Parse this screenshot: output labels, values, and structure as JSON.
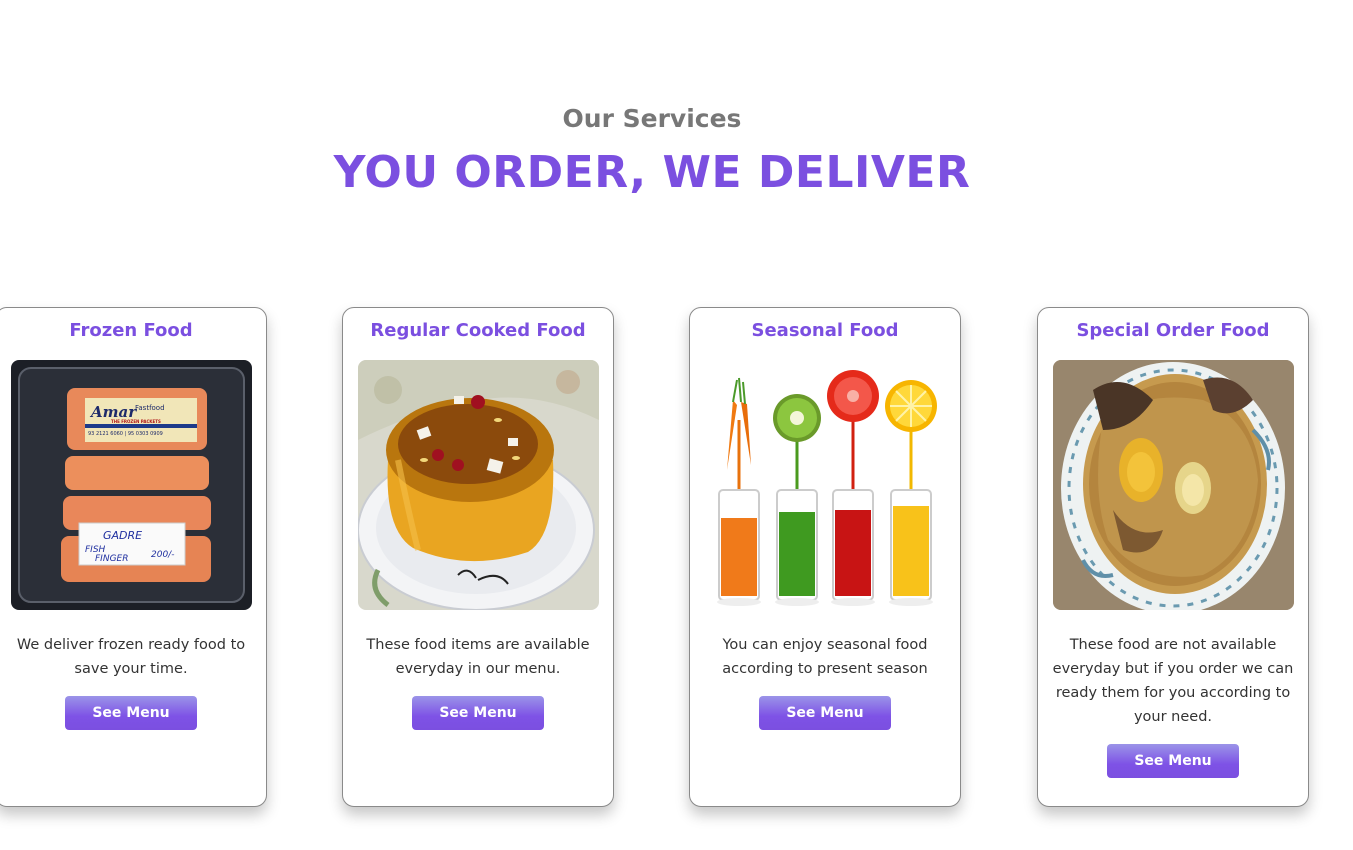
{
  "section": {
    "subtitle": "Our Services",
    "title": "YOU ORDER, WE DELIVER"
  },
  "cards": [
    {
      "title": "Frozen Food",
      "image_icon": "frozen-fish-fingers-photo",
      "description": "We deliver frozen ready food to save your time.",
      "button_label": "See Menu"
    },
    {
      "title": "Regular Cooked Food",
      "image_icon": "pudding-cake-photo",
      "description": "These food items are available everyday in our menu.",
      "button_label": "See Menu"
    },
    {
      "title": "Seasonal Food",
      "image_icon": "fruit-juice-glasses-photo",
      "description": "You can enjoy seasonal food according to present season",
      "button_label": "See Menu"
    },
    {
      "title": "Special Order Food",
      "image_icon": "biryani-plate-photo",
      "description": "These food are not available everyday but if you order we can ready them for you according to your need.",
      "button_label": "See Menu"
    }
  ],
  "package_label": {
    "brand": "Amar",
    "brand_sub": "Fastfood",
    "tagline": "THE FROZEN PACKETS",
    "phone": "93 2121 6060 | 95 0303 0909"
  },
  "package_tag": {
    "line1": "GADRE",
    "line2": "FISH",
    "line3": "FINGER",
    "price": "200/-"
  },
  "colors": {
    "accent": "#7b4fe0",
    "subtitle": "#777777",
    "body_text": "#333333"
  }
}
